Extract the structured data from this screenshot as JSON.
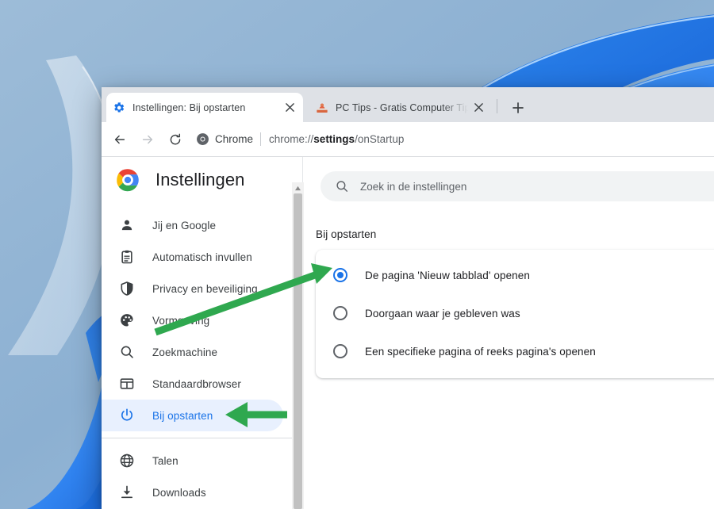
{
  "browser": {
    "tabs": [
      {
        "title": "Instellingen: Bij opstarten",
        "favicon": "gear-icon",
        "active": true,
        "close_label": "×"
      },
      {
        "title": "PC Tips - Gratis Computer Tips, i",
        "favicon": "pc-tips-icon",
        "active": false,
        "close_label": "×"
      }
    ],
    "new_tab_label": "+",
    "toolbar": {
      "back_label": "←",
      "forward_label": "→",
      "reload_label": "⟳",
      "chrome_chip_label": "Chrome",
      "url_prefix": "chrome://",
      "url_bold": "settings",
      "url_suffix": "/onStartup",
      "url_full": "chrome://settings/onStartup"
    }
  },
  "settings": {
    "logo": "chrome-logo",
    "title": "Instellingen",
    "search": {
      "placeholder": "Zoek in de instellingen",
      "icon": "search-icon"
    },
    "sidebar": {
      "items": [
        {
          "label": "Jij en Google",
          "icon": "person-icon",
          "selected": false
        },
        {
          "label": "Automatisch invullen",
          "icon": "clipboard-icon",
          "selected": false
        },
        {
          "label": "Privacy en beveiliging",
          "icon": "shield-icon",
          "selected": false
        },
        {
          "label": "Vormgeving",
          "icon": "palette-icon",
          "selected": false
        },
        {
          "label": "Zoekmachine",
          "icon": "search-icon",
          "selected": false
        },
        {
          "label": "Standaardbrowser",
          "icon": "browser-window-icon",
          "selected": false
        },
        {
          "label": "Bij opstarten",
          "icon": "power-icon",
          "selected": true
        }
      ],
      "items_after_divider": [
        {
          "label": "Talen",
          "icon": "globe-icon",
          "selected": false
        },
        {
          "label": "Downloads",
          "icon": "download-icon",
          "selected": false
        }
      ]
    },
    "main": {
      "section_title": "Bij opstarten",
      "options": [
        {
          "label": "De pagina 'Nieuw tabblad' openen",
          "checked": true
        },
        {
          "label": "Doorgaan waar je gebleven was",
          "checked": false
        },
        {
          "label": "Een specifieke pagina of reeks pagina's openen",
          "checked": false
        }
      ]
    }
  },
  "annotations": {
    "arrow_color": "#2fa84f",
    "arrows": [
      {
        "name": "arrow-to-selected-radio",
        "direction": "up-right"
      },
      {
        "name": "arrow-to-startup-menu-item",
        "direction": "left"
      }
    ]
  },
  "colors": {
    "accent_blue": "#1a73e8",
    "selected_pill": "#e8f0fe",
    "tabstrip": "#dee1e6",
    "desktop": "#8bb0d3",
    "arrow_green": "#2fa84f"
  }
}
